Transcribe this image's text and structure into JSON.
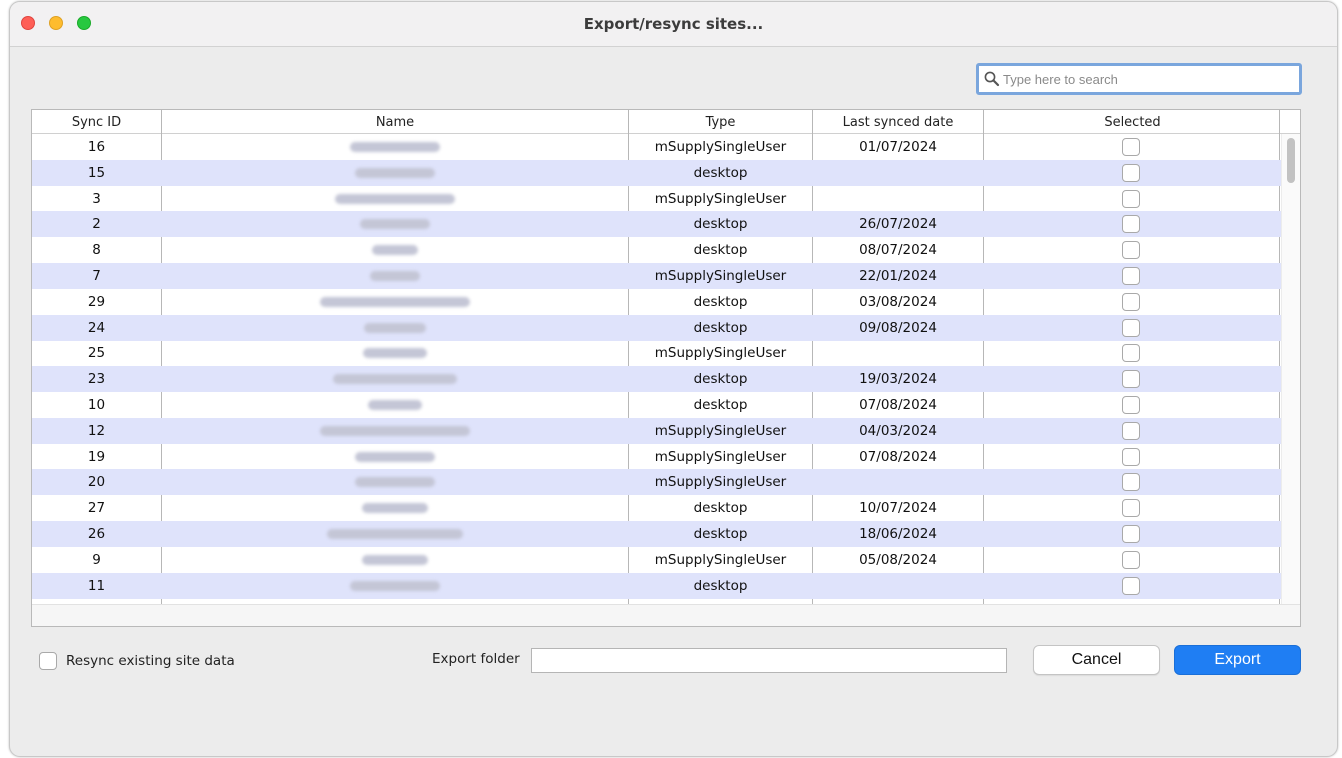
{
  "window": {
    "title": "Export/resync sites..."
  },
  "search": {
    "placeholder": "Type here to search",
    "value": ""
  },
  "table": {
    "columns": [
      "Sync ID",
      "Name",
      "Type",
      "Last synced date",
      "Selected"
    ],
    "rows": [
      {
        "sync_id": "16",
        "type": "mSupplySingleUser",
        "last_synced": "01/07/2024",
        "selected": false
      },
      {
        "sync_id": "15",
        "type": "desktop",
        "last_synced": "",
        "selected": false
      },
      {
        "sync_id": "3",
        "type": "mSupplySingleUser",
        "last_synced": "",
        "selected": false
      },
      {
        "sync_id": "2",
        "type": "desktop",
        "last_synced": "26/07/2024",
        "selected": false
      },
      {
        "sync_id": "8",
        "type": "desktop",
        "last_synced": "08/07/2024",
        "selected": false
      },
      {
        "sync_id": "7",
        "type": "mSupplySingleUser",
        "last_synced": "22/01/2024",
        "selected": false
      },
      {
        "sync_id": "29",
        "type": "desktop",
        "last_synced": "03/08/2024",
        "selected": false
      },
      {
        "sync_id": "24",
        "type": "desktop",
        "last_synced": "09/08/2024",
        "selected": false
      },
      {
        "sync_id": "25",
        "type": "mSupplySingleUser",
        "last_synced": "",
        "selected": false
      },
      {
        "sync_id": "23",
        "type": "desktop",
        "last_synced": "19/03/2024",
        "selected": false
      },
      {
        "sync_id": "10",
        "type": "desktop",
        "last_synced": "07/08/2024",
        "selected": false
      },
      {
        "sync_id": "12",
        "type": "mSupplySingleUser",
        "last_synced": "04/03/2024",
        "selected": false
      },
      {
        "sync_id": "19",
        "type": "mSupplySingleUser",
        "last_synced": "07/08/2024",
        "selected": false
      },
      {
        "sync_id": "20",
        "type": "mSupplySingleUser",
        "last_synced": "",
        "selected": false
      },
      {
        "sync_id": "27",
        "type": "desktop",
        "last_synced": "10/07/2024",
        "selected": false
      },
      {
        "sync_id": "26",
        "type": "desktop",
        "last_synced": "18/06/2024",
        "selected": false
      },
      {
        "sync_id": "9",
        "type": "mSupplySingleUser",
        "last_synced": "05/08/2024",
        "selected": false
      },
      {
        "sync_id": "11",
        "type": "desktop",
        "last_synced": "",
        "selected": false
      }
    ]
  },
  "options": {
    "resync_label": "Resync existing site data",
    "resync_checked": false,
    "export_folder_label": "Export folder",
    "export_folder_value": ""
  },
  "buttons": {
    "cancel": "Cancel",
    "export": "Export"
  },
  "colors": {
    "accent": "#1f7ef3",
    "alt_row": "#dfe3fb",
    "focus_ring": "#7aa6dd"
  }
}
